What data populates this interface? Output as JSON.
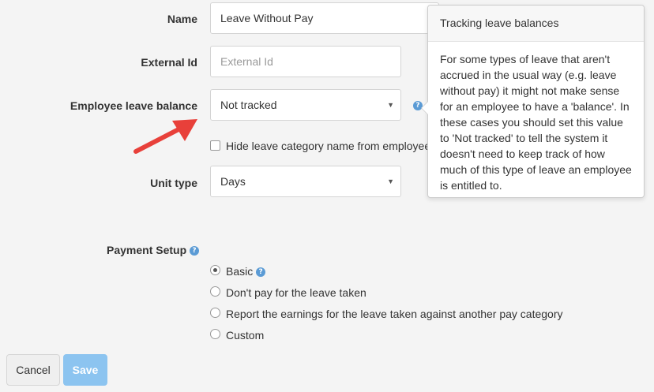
{
  "form": {
    "name_label": "Name",
    "name_value": "Leave Without Pay",
    "external_id_label": "External Id",
    "external_id_placeholder": "External Id",
    "balance_label": "Employee leave balance",
    "balance_value": "Not tracked",
    "hide_label": "Hide leave category name from employee",
    "unit_type_label": "Unit type",
    "unit_type_value": "Days",
    "help_glyph": "?",
    "arrow_glyph": "▼"
  },
  "tooltip": {
    "title": "Tracking leave balances",
    "body": "For some types of leave that aren't accrued in the usual way (e.g. leave without pay) it might not make sense for an employee to have a 'balance'. In these cases you should set this value to 'Not tracked' to tell the system it doesn't need to keep track of how much of this type of leave an employee is entitled to."
  },
  "payment": {
    "label": "Payment Setup",
    "options": [
      {
        "label": "Basic",
        "selected": true
      },
      {
        "label": "Don't pay for the leave taken",
        "selected": false
      },
      {
        "label": "Report the earnings for the leave taken against another pay category",
        "selected": false
      },
      {
        "label": "Custom",
        "selected": false
      }
    ]
  },
  "buttons": {
    "cancel": "Cancel",
    "save": "Save"
  },
  "colors": {
    "annotation_arrow": "#e8403a",
    "help_icon": "#5b9bd5",
    "save_button": "#8cc4f0"
  }
}
